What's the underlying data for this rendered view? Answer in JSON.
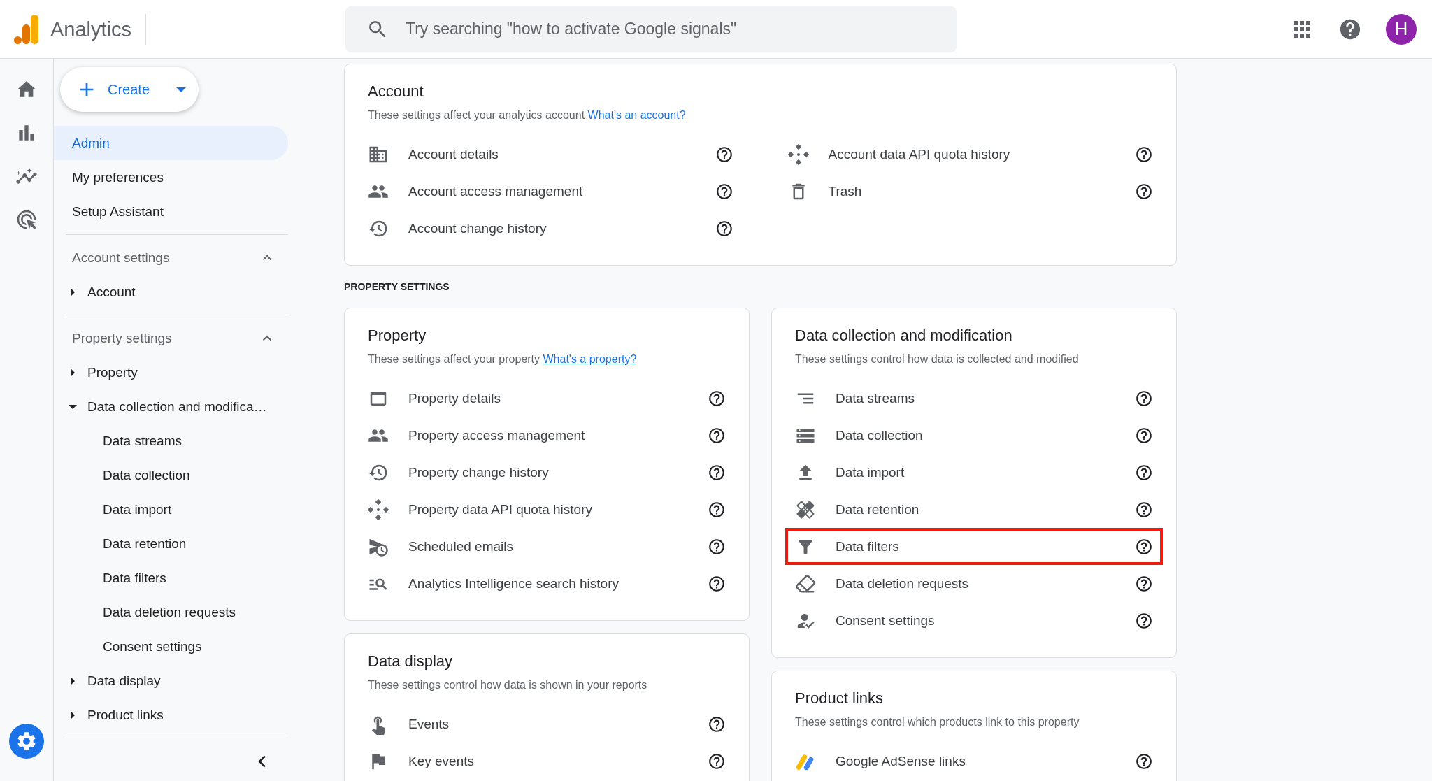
{
  "app": {
    "name": "Analytics"
  },
  "search": {
    "placeholder": "Try searching \"how to activate Google signals\""
  },
  "avatar": {
    "initial": "H"
  },
  "create_button": {
    "label": "Create"
  },
  "sidebar": {
    "items": [
      {
        "label": "Admin",
        "selected": true
      },
      {
        "label": "My preferences",
        "selected": false
      },
      {
        "label": "Setup Assistant",
        "selected": false
      }
    ],
    "sections": [
      {
        "title": "Account settings",
        "expanded": true,
        "items": [
          {
            "label": "Account",
            "expanded": false
          }
        ]
      },
      {
        "title": "Property settings",
        "expanded": true,
        "items": [
          {
            "label": "Property",
            "expanded": false
          },
          {
            "label": "Data collection and modifica…",
            "expanded": true,
            "children": [
              "Data streams",
              "Data collection",
              "Data import",
              "Data retention",
              "Data filters",
              "Data deletion requests",
              "Consent settings"
            ]
          },
          {
            "label": "Data display",
            "expanded": false
          },
          {
            "label": "Product links",
            "expanded": false
          }
        ]
      }
    ]
  },
  "account_card": {
    "title": "Account",
    "description": "These settings affect your analytics account",
    "link": "What's an account?",
    "items": [
      {
        "label": "Account details"
      },
      {
        "label": "Account access management"
      },
      {
        "label": "Account change history"
      },
      {
        "label": "Account data API quota history"
      },
      {
        "label": "Trash"
      }
    ]
  },
  "property_settings": {
    "label": "PROPERTY SETTINGS",
    "columns": [
      [
        {
          "title": "Property",
          "description": "These settings affect your property",
          "link": "What's a property?",
          "items": [
            {
              "label": "Property details"
            },
            {
              "label": "Property access management"
            },
            {
              "label": "Property change history"
            },
            {
              "label": "Property data API quota history"
            },
            {
              "label": "Scheduled emails"
            },
            {
              "label": "Analytics Intelligence search history"
            }
          ]
        },
        {
          "title": "Data display",
          "description": "These settings control how data is shown in your reports",
          "items": [
            {
              "label": "Events"
            },
            {
              "label": "Key events"
            }
          ]
        }
      ],
      [
        {
          "title": "Data collection and modification",
          "description": "These settings control how data is collected and modified",
          "items": [
            {
              "label": "Data streams",
              "highlighted": false
            },
            {
              "label": "Data collection",
              "highlighted": false
            },
            {
              "label": "Data import",
              "highlighted": false
            },
            {
              "label": "Data retention",
              "highlighted": false
            },
            {
              "label": "Data filters",
              "highlighted": true
            },
            {
              "label": "Data deletion requests",
              "highlighted": false
            },
            {
              "label": "Consent settings",
              "highlighted": false
            }
          ]
        },
        {
          "title": "Product links",
          "description": "These settings control which products link to this property",
          "items": [
            {
              "label": "Google AdSense links"
            }
          ]
        }
      ]
    ]
  }
}
